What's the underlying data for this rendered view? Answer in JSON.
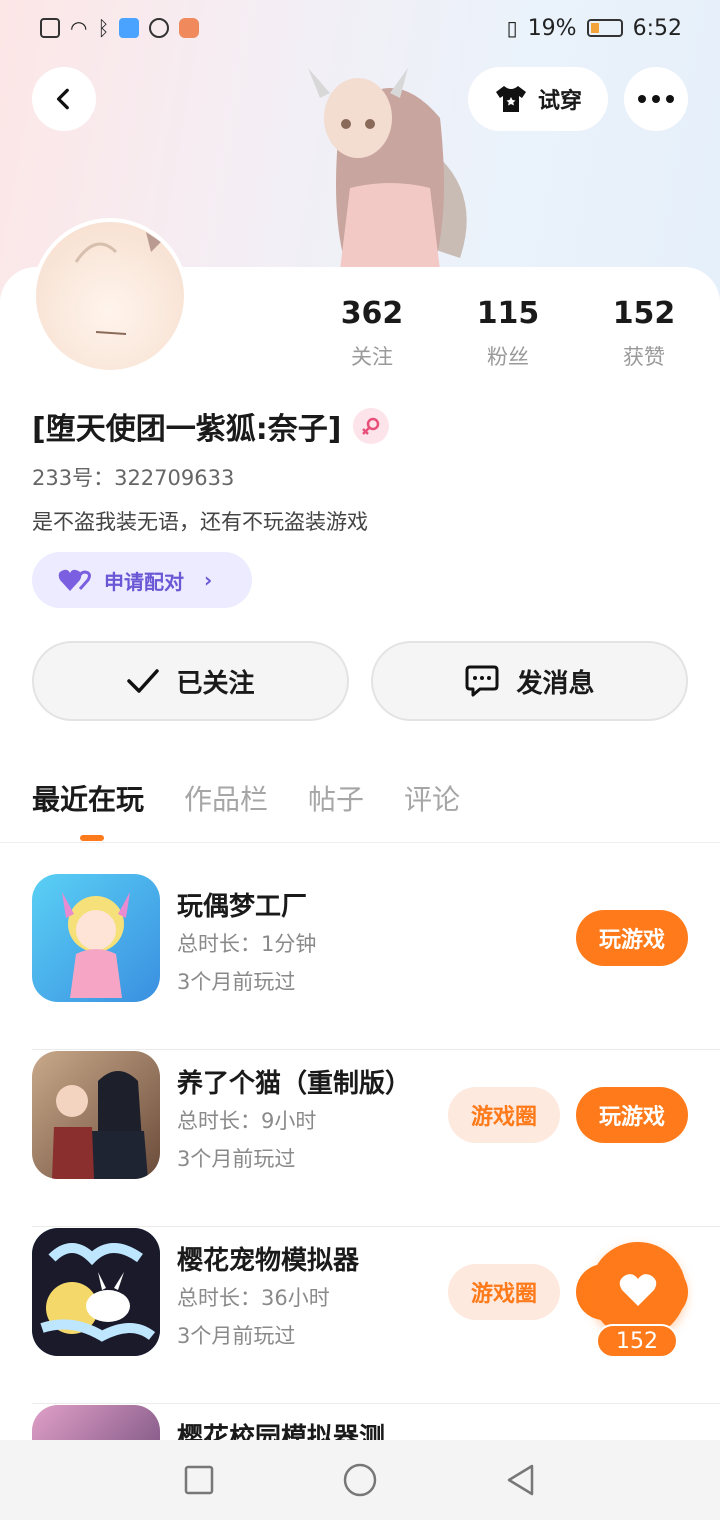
{
  "status_bar": {
    "battery_percent": "19%",
    "time": "6:52"
  },
  "header": {
    "try_on_label": "试穿"
  },
  "profile": {
    "name": "[堕天使团一紫狐:奈子]",
    "uid": "233号：322709633",
    "bio": "是不盗我装无语，还有不玩盗装游戏",
    "pair_label": "申请配对",
    "stats": [
      {
        "value": "362",
        "label": "关注"
      },
      {
        "value": "115",
        "label": "粉丝"
      },
      {
        "value": "152",
        "label": "获赞"
      }
    ],
    "follow_label": "已关注",
    "message_label": "发消息"
  },
  "tabs": [
    "最近在玩",
    "作品栏",
    "帖子",
    "评论"
  ],
  "games": [
    {
      "title": "玩偶梦工厂",
      "duration": "总时长：1分钟",
      "last_played": "3个月前玩过",
      "circle_label": "",
      "play_label": "玩游戏"
    },
    {
      "title": "养了个猫（重制版）",
      "duration": "总时长：9小时",
      "last_played": "3个月前玩过",
      "circle_label": "游戏圈",
      "play_label": "玩游戏"
    },
    {
      "title": "樱花宠物模拟器",
      "duration": "总时长：36小时",
      "last_played": "3个月前玩过",
      "circle_label": "游戏圈",
      "play_label": "玩游戏"
    },
    {
      "title": "樱花校园模拟器测...",
      "duration": "",
      "last_played": "",
      "circle_label": "",
      "play_label": ""
    }
  ],
  "like_fab": {
    "count": "152"
  },
  "colors": {
    "accent": "#ff7a1a",
    "pair_purple": "#6b57d6"
  }
}
